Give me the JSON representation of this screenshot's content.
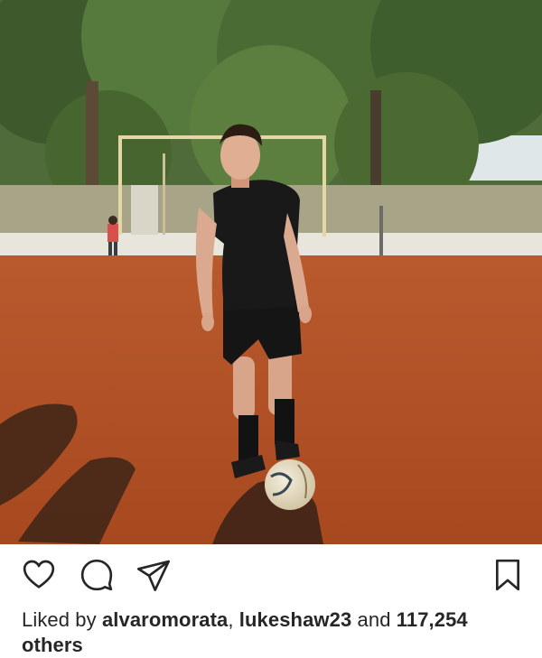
{
  "post": {
    "image": {
      "subject": "man-with-football-on-dirt-field"
    },
    "actions": {
      "like_icon": "heart-icon",
      "comment_icon": "comment-icon",
      "share_icon": "direct-share-icon",
      "save_icon": "bookmark-icon"
    },
    "likes": {
      "prefix": "Liked by ",
      "user1": "alvaromorata",
      "separator": ", ",
      "user2": "lukeshaw23",
      "connector": " and ",
      "count_text": "117,254 others"
    }
  },
  "colors": {
    "icon_stroke": "#262626",
    "text": "#262626"
  }
}
